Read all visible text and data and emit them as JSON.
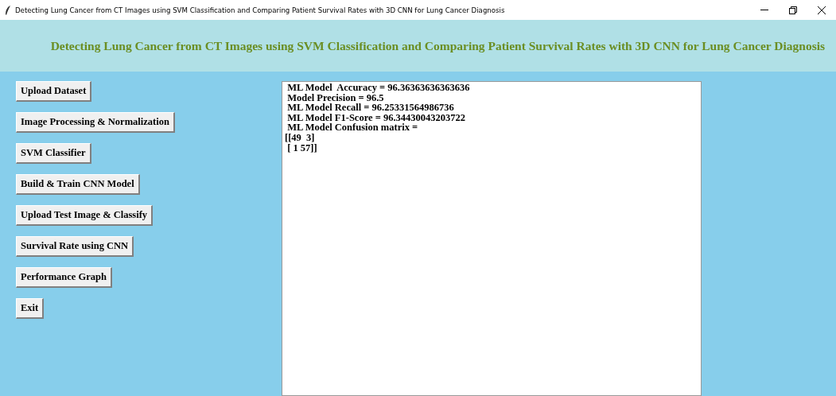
{
  "window": {
    "title": "Detecting Lung Cancer from CT Images using SVM Classification and Comparing Patient Survival Rates with 3D CNN for Lung Cancer Diagnosis"
  },
  "header": {
    "title": "Detecting Lung Cancer from CT Images using SVM Classification and Comparing Patient Survival Rates with 3D CNN for Lung Cancer Diagnosis"
  },
  "buttons": [
    "Upload Dataset",
    "Image Processing & Normalization",
    "SVM Classifier",
    "Build & Train CNN Model",
    "Upload Test Image & Classify",
    "Survival Rate using CNN",
    "Performance Graph",
    "Exit"
  ],
  "output": {
    "lines": [
      " ML Model  Accuracy = 96.36363636363636",
      " Model Precision = 96.5",
      " ML Model Recall = 96.25331564986736",
      " ML Model F1-Score = 96.34430043203722",
      " ML Model Confusion matrix = ",
      "[[49  3]",
      " [ 1 57]]"
    ]
  }
}
